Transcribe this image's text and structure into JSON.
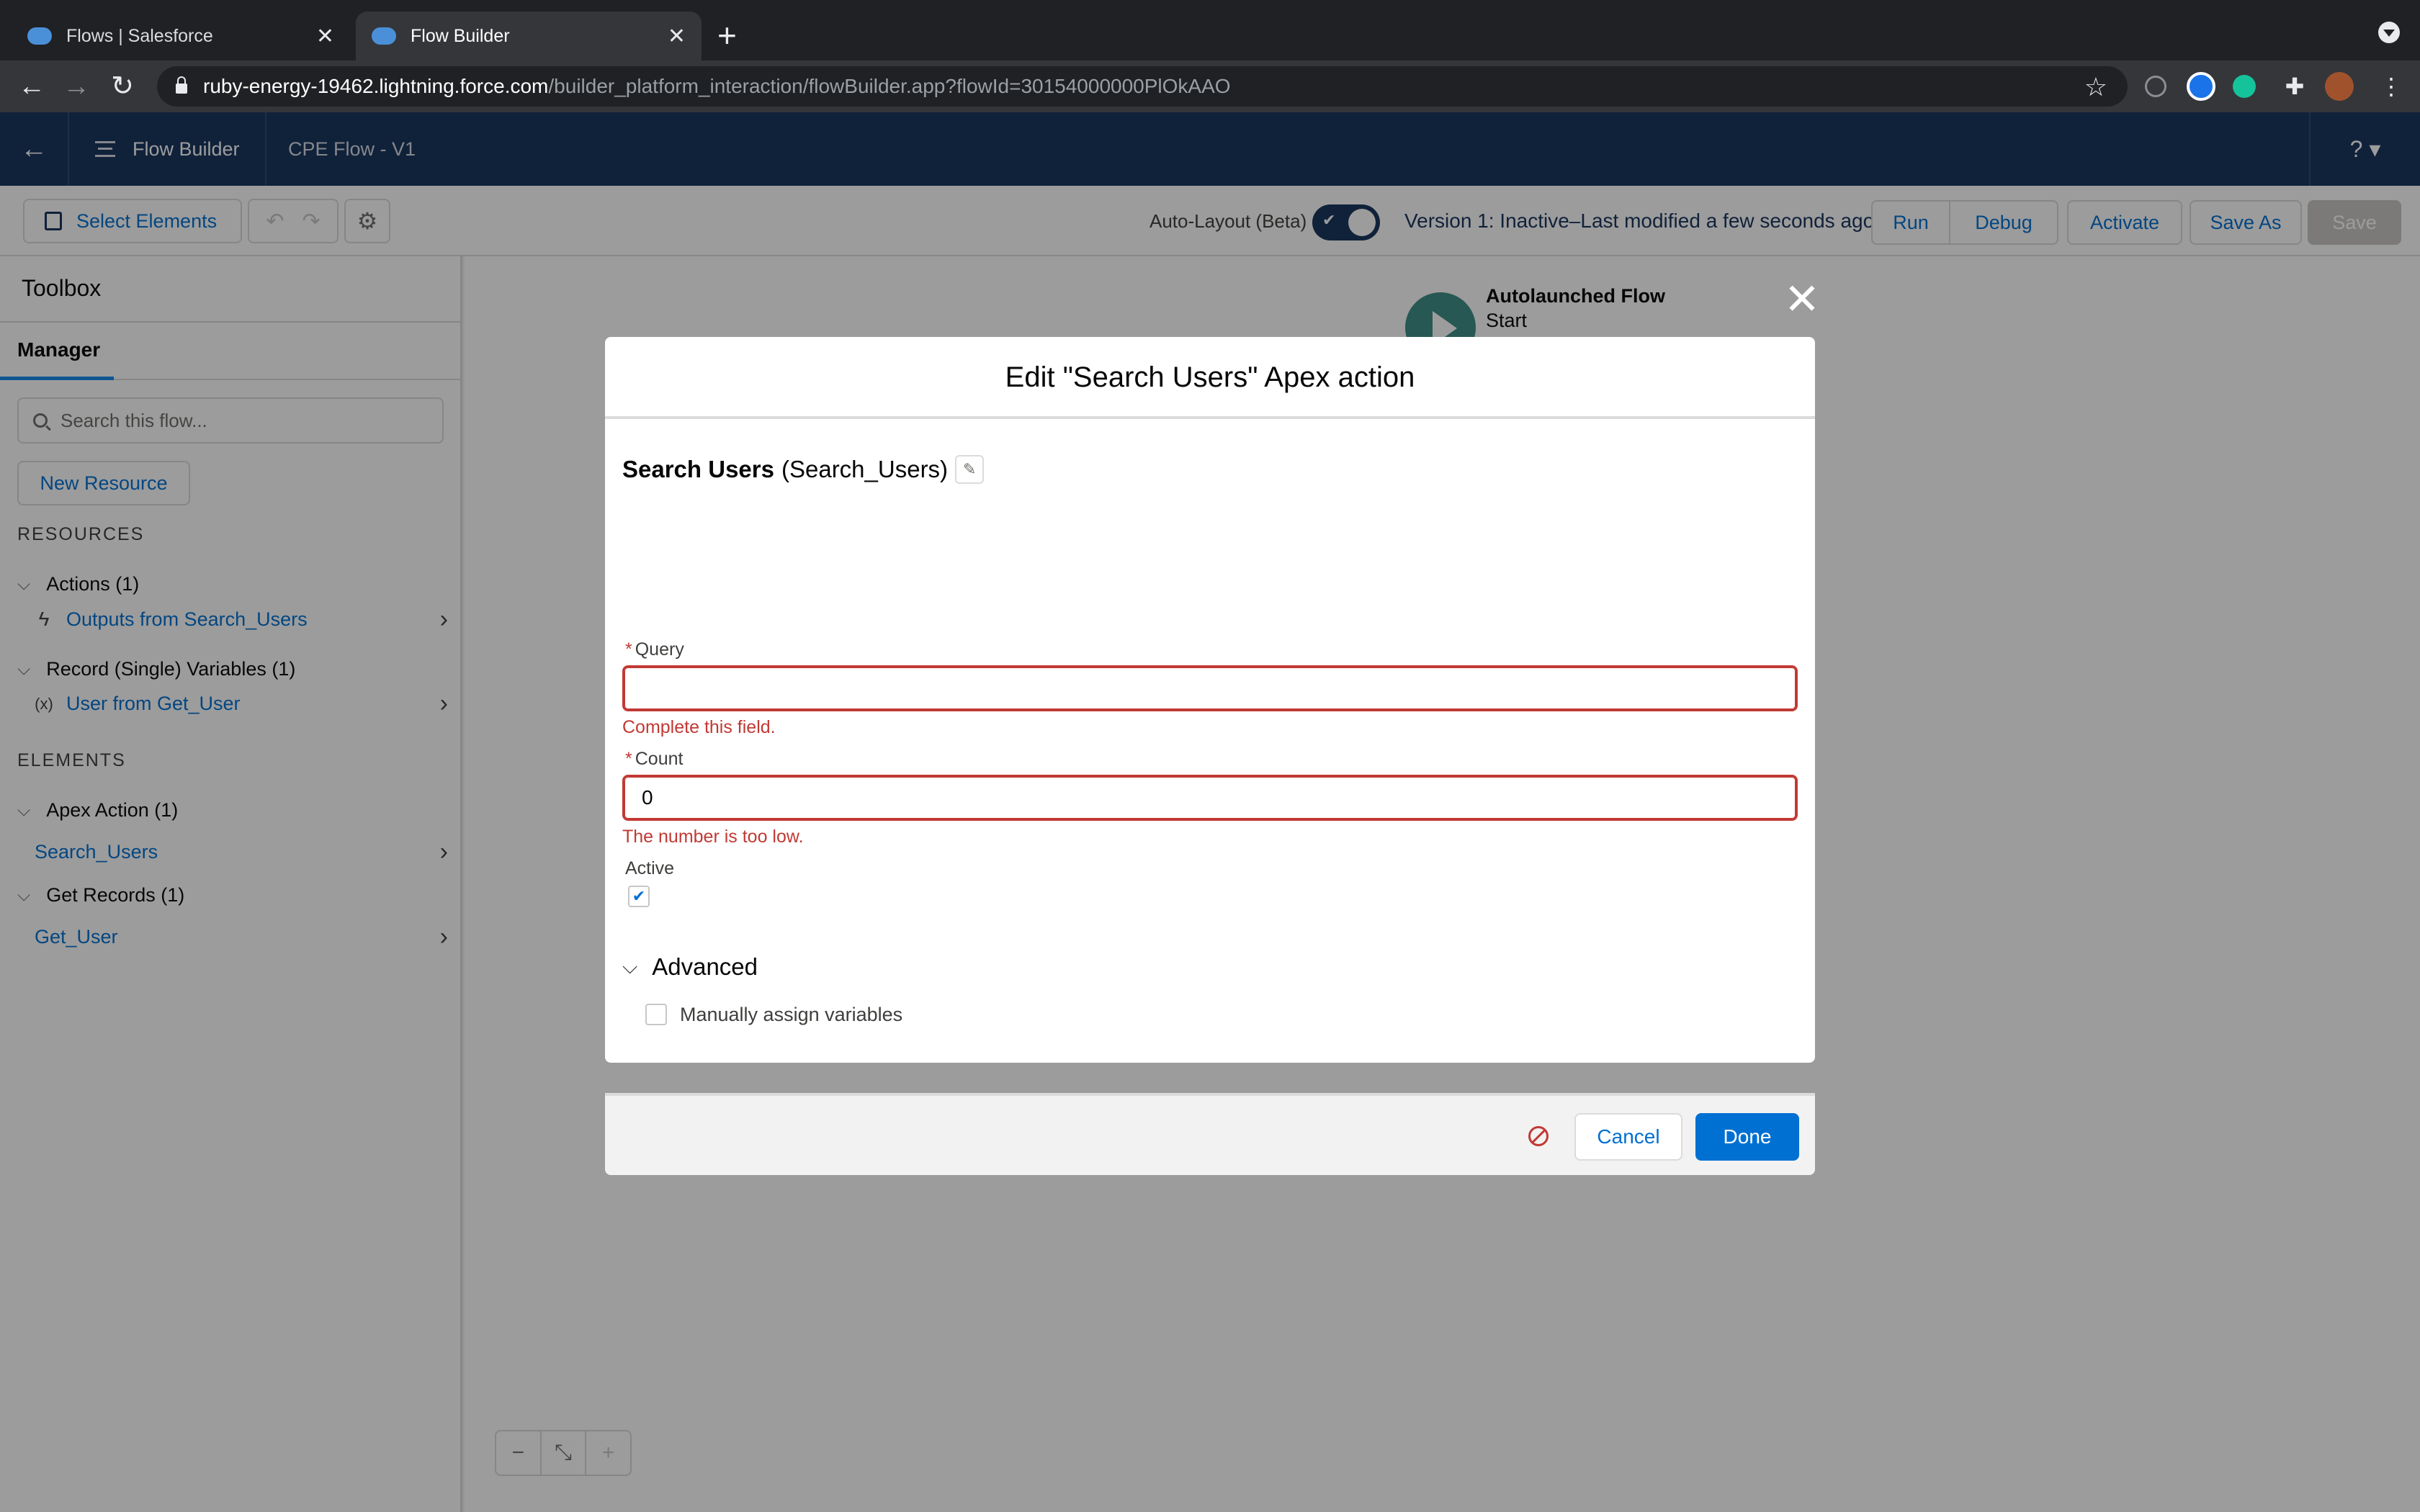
{
  "browser": {
    "tabs": [
      {
        "title": "Flows | Salesforce"
      },
      {
        "title": "Flow Builder"
      }
    ],
    "url_host": "ruby-energy-19462.lightning.force.com",
    "url_path": "/builder_platform_interaction/flowBuilder.app?flowId=30154000000PlOkAAO"
  },
  "header": {
    "app_name": "Flow Builder",
    "flow_name": "CPE Flow - V1",
    "help_label": "? ▾"
  },
  "toolbar": {
    "select_elements": "Select Elements",
    "auto_layout_label": "Auto-Layout (Beta)",
    "auto_layout_on": true,
    "version_status": "Version 1: Inactive–Last modified a few seconds ago",
    "run": "Run",
    "debug": "Debug",
    "activate": "Activate",
    "save_as": "Save As",
    "save": "Save"
  },
  "toolbox": {
    "title": "Toolbox",
    "tab": "Manager",
    "search_placeholder": "Search this flow...",
    "new_resource": "New Resource",
    "resources_heading": "RESOURCES",
    "resource_groups": [
      {
        "label": "Actions (1)",
        "items": [
          {
            "label": "Outputs from Search_Users",
            "icon": "lightning-icon"
          }
        ]
      },
      {
        "label": "Record (Single) Variables (1)",
        "items": [
          {
            "label": "User from Get_User",
            "icon": "variable-icon"
          }
        ]
      }
    ],
    "elements_heading": "ELEMENTS",
    "element_groups": [
      {
        "label": "Apex Action (1)",
        "items": [
          {
            "label": "Search_Users"
          }
        ]
      },
      {
        "label": "Get Records (1)",
        "items": [
          {
            "label": "Get_User"
          }
        ]
      }
    ]
  },
  "canvas": {
    "start_title": "Autolaunched Flow",
    "start_subtitle": "Start"
  },
  "modal": {
    "title": "Edit \"Search Users\" Apex action",
    "action_label": "Search Users",
    "action_api_name": "(Search_Users)",
    "query_label": "Query",
    "query_value": "",
    "query_error": "Complete this field.",
    "count_label": "Count",
    "count_value": "0",
    "count_error": "The number is too low.",
    "active_label": "Active",
    "active_checked": true,
    "advanced_label": "Advanced",
    "manual_assign_label": "Manually assign variables",
    "manual_assign_checked": false,
    "cancel": "Cancel",
    "done": "Done"
  },
  "colors": {
    "header_navy": "#16325c",
    "brand_blue": "#0070d2",
    "error_red": "#c23934",
    "start_node_teal": "#3d8e86"
  }
}
